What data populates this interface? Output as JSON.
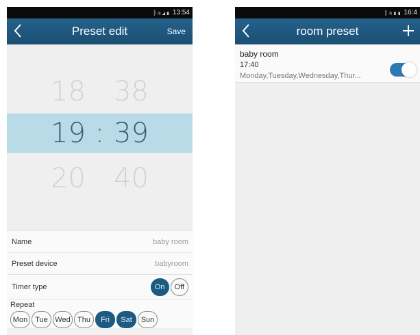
{
  "left": {
    "status": {
      "signal": "ᛒ≋◢▮",
      "time": "13:54"
    },
    "nav": {
      "back_icon": "chevron-left-icon",
      "title": "Preset edit",
      "save": "Save"
    },
    "picker": {
      "above": {
        "hour": "18",
        "minute": "38"
      },
      "selected": {
        "hour": "19",
        "separator": ":",
        "minute": "39"
      },
      "below": {
        "hour": "20",
        "minute": "40"
      }
    },
    "form": {
      "name_label": "Name",
      "name_value": "baby room",
      "device_label": "Preset device",
      "device_value": "babyroom",
      "timer_label": "Timer type",
      "timer_on": "On",
      "timer_off": "Off",
      "timer_selected": "On",
      "repeat_label": "Repeat",
      "days": [
        "Mon",
        "Tue",
        "Wed",
        "Thu",
        "Fri",
        "Sat",
        "Sun"
      ],
      "days_selected": [
        "Fri",
        "Sat"
      ]
    }
  },
  "right": {
    "status": {
      "signal": "ᛒ≋▮▮",
      "time": "16:4"
    },
    "nav": {
      "back_icon": "chevron-left-icon",
      "title": "room preset",
      "add_icon": "plus-icon"
    },
    "preset": {
      "name": "baby room",
      "time": "17:40",
      "days": "Monday,Tuesday,Wednesday,Thur...",
      "enabled": true
    }
  },
  "colors": {
    "navbar": "#1f5a80",
    "accent": "#1c5a82",
    "selection": "#b9dbe8",
    "switch": "#2f79b3"
  }
}
